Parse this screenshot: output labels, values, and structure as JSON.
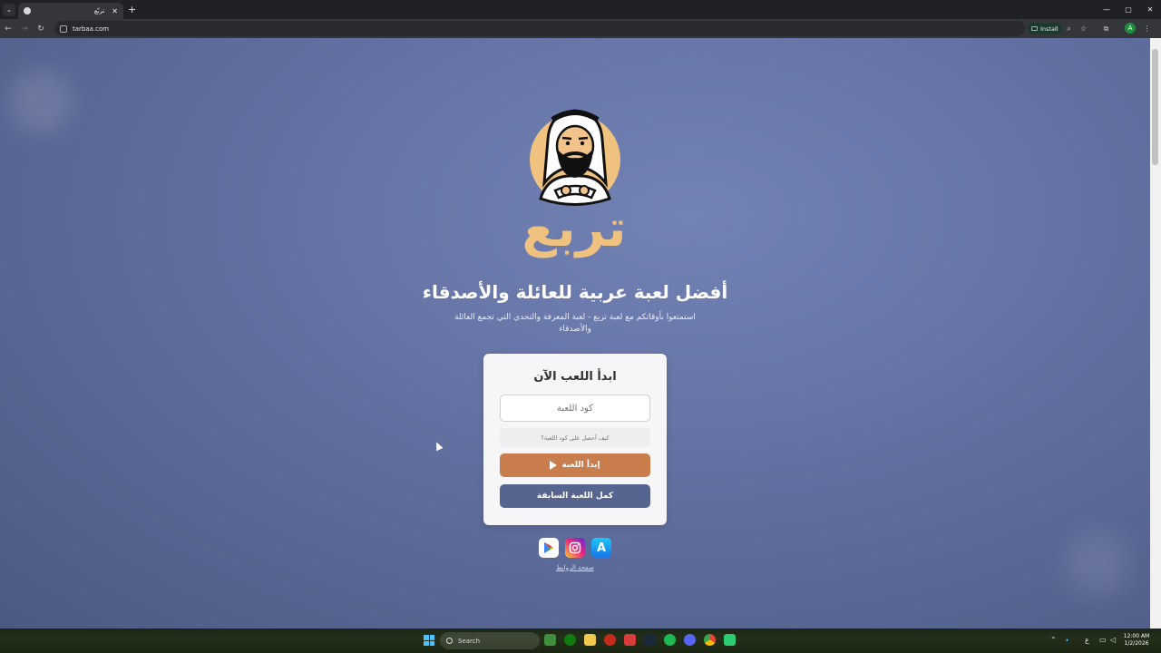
{
  "browser": {
    "tab_title": "تربّع",
    "url": "tarbaa.com",
    "install_label": "Install",
    "profile_initial": "A",
    "window_controls": [
      "—",
      "▢",
      "✕"
    ]
  },
  "page": {
    "wordmark": "تربع",
    "headline": "أفضل لعبة عربية للعائلة والأصدقاء",
    "subline": "استمتعوا بأوقاتكم مع لعبة تربع - لعبة المعرفة والتحدي التي تجمع العائلة والأصدقاء",
    "card": {
      "title": "ابدأ اللعب الآن",
      "code_placeholder": "كود اللعبة",
      "help_label": "كيف أحصل على كود اللعبة؟",
      "start_label": "إبدأ اللعبة",
      "continue_label": "كمل اللعبة السابقة"
    },
    "links_label": "صفحة الروابط",
    "accent": "#c97d4c",
    "secondary": "#56658f",
    "brand_gold": "#f0c27f"
  },
  "taskbar": {
    "search_label": "Search",
    "time": "12:00 AM",
    "date": "1/2/2026",
    "lang": "ع"
  }
}
